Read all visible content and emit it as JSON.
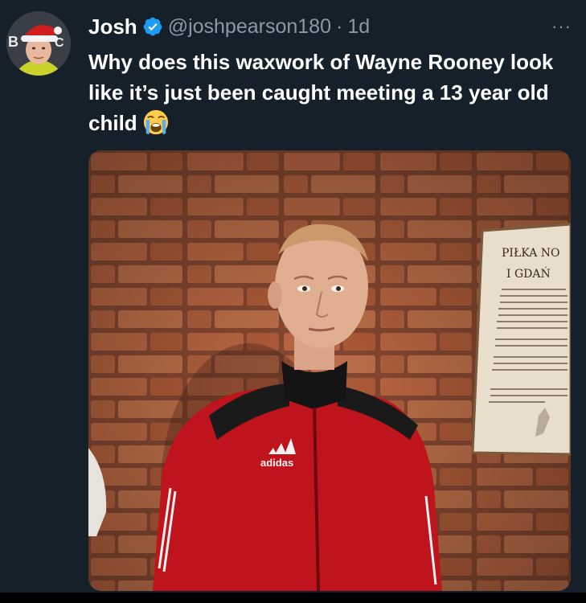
{
  "tweet": {
    "author": {
      "name": "Josh",
      "handle": "@joshpearson180",
      "verified_icon": "verified-badge-icon"
    },
    "separator": "·",
    "time": "1d",
    "more_label": "···",
    "text": "Why does this waxwork of Wayne Rooney look like it’s just been caught meeting a 13 year old child",
    "emoji_icon": "loudly-crying-face-emoji"
  },
  "media": {
    "plaque": {
      "line1": "PIŁKA NO",
      "line2": "I GDAŃ"
    },
    "jacket_logo": "adidas"
  },
  "colors": {
    "background": "#15202b",
    "text_primary": "#ffffff",
    "text_secondary": "#8b98a5",
    "verified_blue": "#1d9bf0",
    "jacket_red": "#c0141c",
    "brick": "#b5623d"
  }
}
